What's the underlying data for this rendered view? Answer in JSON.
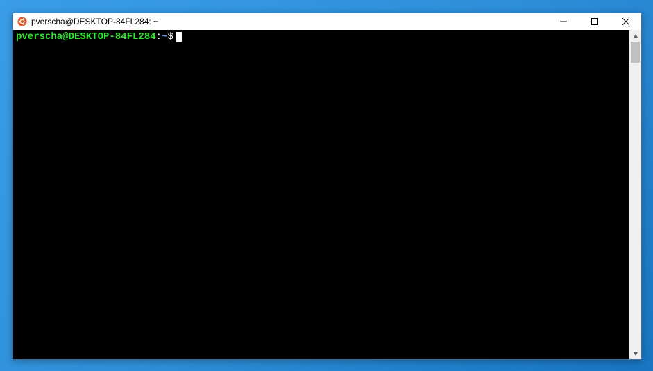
{
  "window": {
    "title": "pverscha@DESKTOP-84FL284: ~"
  },
  "terminal": {
    "prompt": {
      "userhost": "pverscha@DESKTOP-84FL284",
      "colon": ":",
      "path": "~",
      "dollar": "$"
    }
  }
}
